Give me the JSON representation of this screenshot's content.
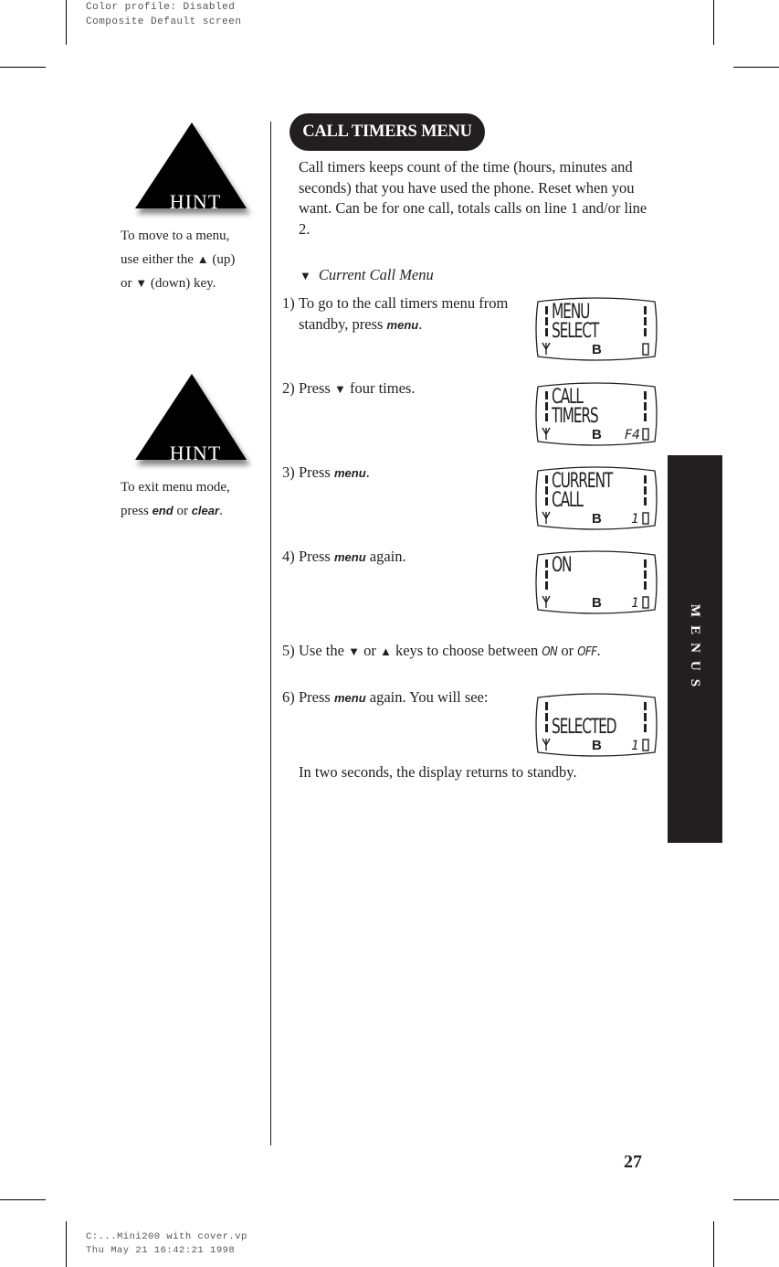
{
  "print_slug": {
    "top": [
      "Color profile: Disabled",
      "Composite  Default screen"
    ],
    "bottom": [
      "C:...Mini200 with cover.vp",
      "Thu May 21 16:42:21 1998"
    ]
  },
  "hints": [
    {
      "badge": "HINT",
      "lines": [
        {
          "text": "To move to a menu,"
        },
        {
          "pre": "use either the ",
          "arrow": "▲",
          "post": " (up)"
        },
        {
          "pre": "or ",
          "arrow": "▼",
          "post": " (down) key."
        }
      ]
    },
    {
      "badge": "HINT",
      "lines": [
        {
          "text": "To exit menu mode,"
        },
        {
          "pre": "press ",
          "key1": "end",
          "mid": " or ",
          "key2": "clear",
          "post": "."
        }
      ]
    }
  ],
  "section": {
    "title": "CALL TIMERS MENU",
    "intro": "Call timers keeps count of the time (hours, minutes and seconds) that you have used the phone. Reset when you want. Can be for one call, totals calls on line 1 and/or line 2.",
    "subhead": {
      "arrow": "▼",
      "label": "Current Call Menu"
    }
  },
  "steps": [
    {
      "num": "1)",
      "line1": "To go to the call timers menu from",
      "line2_pre": "standby, press ",
      "key": "menu",
      "line2_post": "."
    },
    {
      "num": "2)",
      "pre": "Press ",
      "arrow": "▼",
      "post": " four times."
    },
    {
      "num": "3)",
      "pre": "Press ",
      "key": "menu",
      "post": "."
    },
    {
      "num": "4)",
      "pre": "Press ",
      "key": "menu",
      "post": " again."
    },
    {
      "num": "5)",
      "pre": "Use the ",
      "arrow1": "▼",
      "mid1": " or ",
      "arrow2": "▲",
      "mid2": " keys to choose between ",
      "opt1": "ON",
      "mid3": " or ",
      "opt2": "OFF",
      "post": "."
    },
    {
      "num": "6)",
      "pre": "Press ",
      "key": "menu",
      "post": " again. You will see:"
    }
  ],
  "displays": [
    {
      "line1": "MENU",
      "line2": "SELECT",
      "channel": "B",
      "indicator": ""
    },
    {
      "line1": "CALL",
      "line2": "TIMERS",
      "channel": "B",
      "indicator": "F4"
    },
    {
      "line1": "CURRENT",
      "line2": "CALL",
      "channel": "B",
      "indicator": "1"
    },
    {
      "line1": "ON",
      "line2": "",
      "channel": "B",
      "indicator": "1"
    },
    {
      "line1": "",
      "line2": "SELECTED",
      "channel": "B",
      "indicator": "1"
    }
  ],
  "closing": "In two seconds, the display returns to standby.",
  "side_tab": "MENUS",
  "page_number": "27"
}
